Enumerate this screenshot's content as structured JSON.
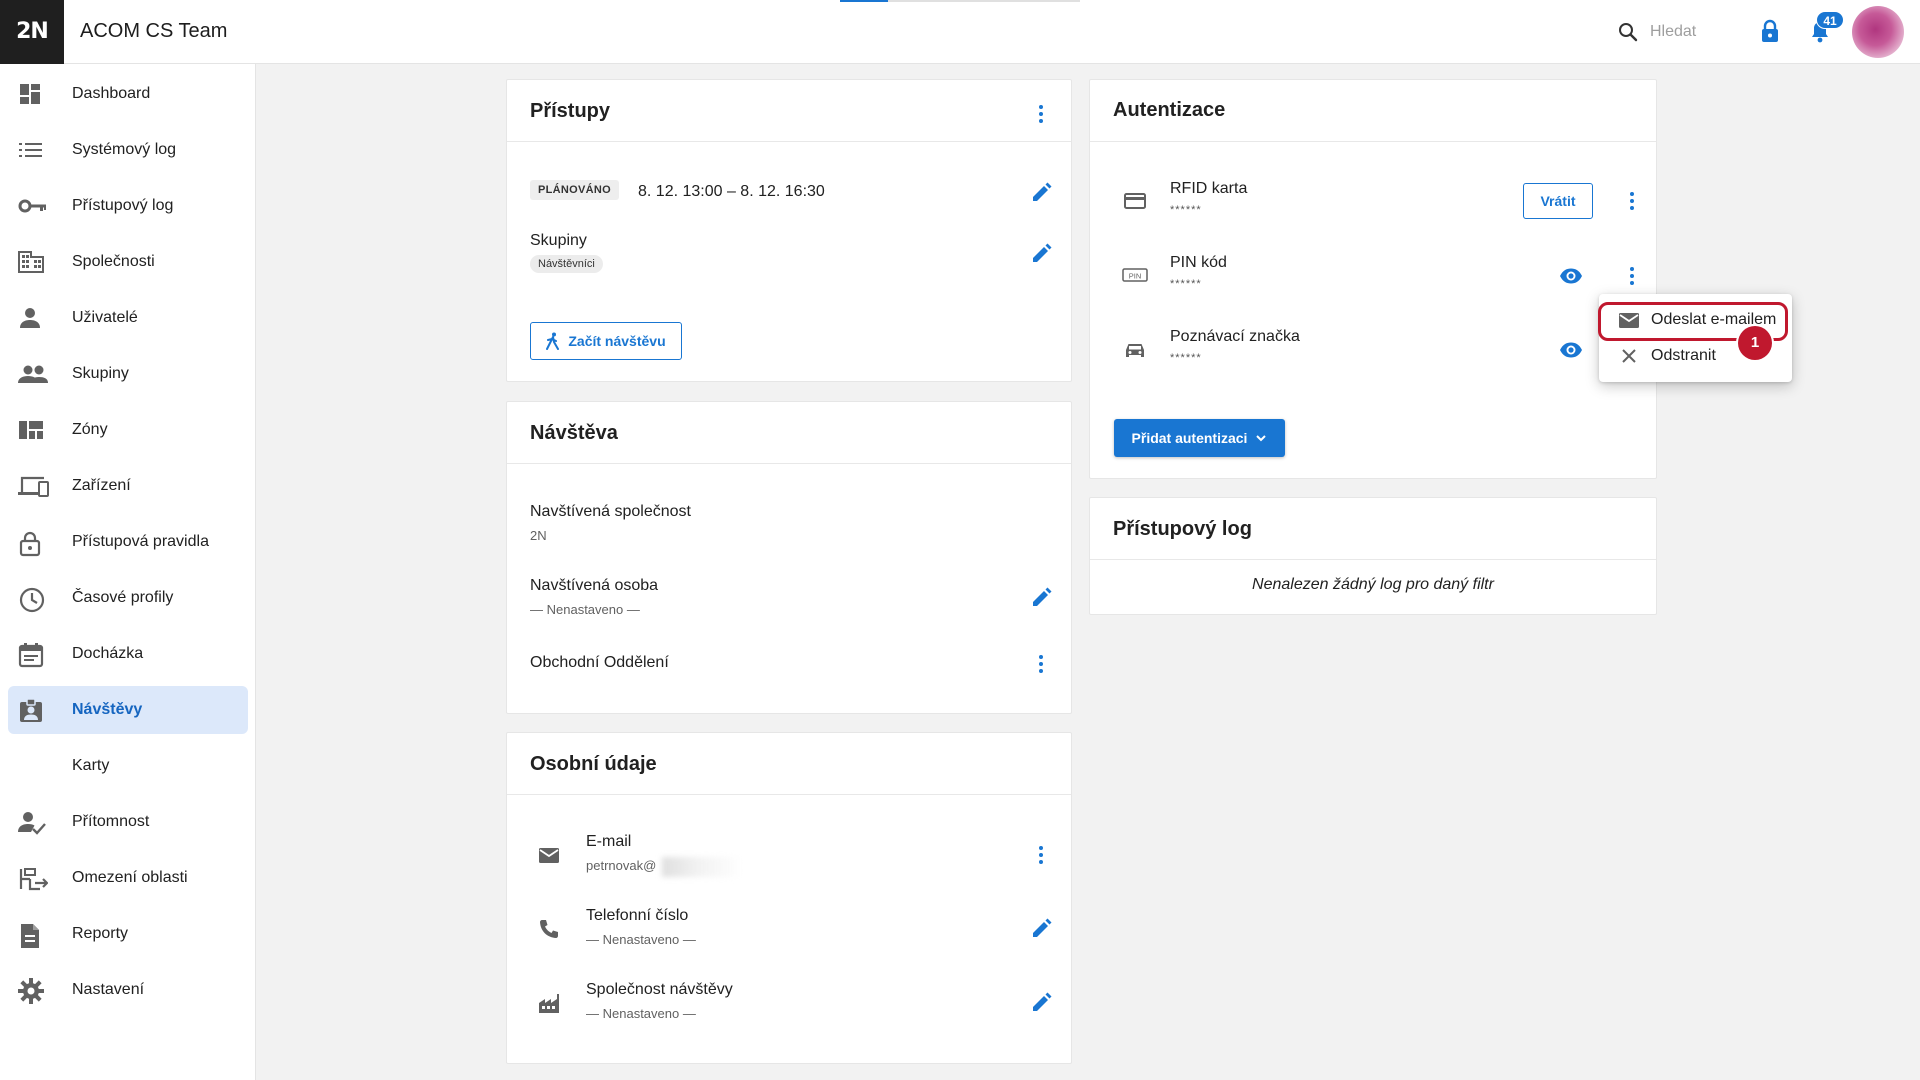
{
  "topbar": {
    "logo": "2N",
    "title": "ACOM CS Team",
    "search_placeholder": "Hledat",
    "notifications_count": "41",
    "progress_fraction": 0.2
  },
  "sidebar": {
    "items": [
      {
        "label": "Dashboard",
        "icon": "dashboard-icon"
      },
      {
        "label": "Systémový log",
        "icon": "list-icon"
      },
      {
        "label": "Přístupový log",
        "icon": "key-icon"
      },
      {
        "label": "Společnosti",
        "icon": "building-icon"
      },
      {
        "label": "Uživatelé",
        "icon": "person-icon"
      },
      {
        "label": "Skupiny",
        "icon": "group-icon"
      },
      {
        "label": "Zóny",
        "icon": "zones-icon"
      },
      {
        "label": "Zařízení",
        "icon": "devices-icon"
      },
      {
        "label": "Přístupová pravidla",
        "icon": "lock-icon"
      },
      {
        "label": "Časové profily",
        "icon": "clock-icon"
      },
      {
        "label": "Docházka",
        "icon": "calendar-icon"
      },
      {
        "label": "Návštěvy",
        "icon": "visitor-badge-icon"
      },
      {
        "label": "Karty",
        "icon": ""
      },
      {
        "label": "Přítomnost",
        "icon": "person-check-icon"
      },
      {
        "label": "Omezení oblasti",
        "icon": "area-restriction-icon"
      },
      {
        "label": "Reporty",
        "icon": "report-icon"
      },
      {
        "label": "Nastavení",
        "icon": "gear-icon"
      }
    ],
    "active_index": 11,
    "accent": "#1565c0",
    "active_bg": "#dce8fa"
  },
  "access": {
    "title": "Přístupy",
    "status_tag": "PLÁNOVÁNO",
    "time_range": "8. 12. 13:00 – 8. 12. 16:30",
    "groups_label": "Skupiny",
    "groups_chip": "Návštěvníci",
    "start_button": "Začít návštěvu"
  },
  "visit": {
    "title": "Návštěva",
    "company_label": "Navštívená společnost",
    "company_value": "2N",
    "person_label": "Navštívená osoba",
    "person_value": "— Nenastaveno —",
    "department_label": "Obchodní Oddělení"
  },
  "personal": {
    "title": "Osobní údaje",
    "email_label": "E-mail",
    "email_value": "petrnovak@",
    "phone_label": "Telefonní číslo",
    "phone_value": "— Nenastaveno —",
    "company_label": "Společnost návštěvy",
    "company_value": "— Nenastaveno —"
  },
  "auth": {
    "title": "Autentizace",
    "rows": [
      {
        "label": "RFID karta",
        "value": "******",
        "icon": "card-icon"
      },
      {
        "label": "PIN kód",
        "value": "******",
        "icon": "pin-icon"
      },
      {
        "label": "Poznávací značka",
        "value": "******",
        "icon": "car-icon"
      }
    ],
    "return_button": "Vrátit",
    "add_button": "Přidat autentizaci"
  },
  "access_log": {
    "title": "Přístupový log",
    "empty_text": "Nenalezen žádný log pro daný filtr"
  },
  "menu": {
    "items": [
      {
        "label": "Odeslat e-mailem",
        "icon": "mail-icon"
      },
      {
        "label": "Odstranit",
        "icon": "close-icon"
      }
    ]
  },
  "annotation": {
    "step_number": "1",
    "color": "#c0182e"
  }
}
